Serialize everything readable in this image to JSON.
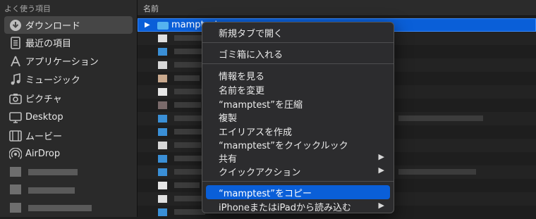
{
  "sidebar": {
    "header": "よく使う項目",
    "items": [
      {
        "label": "ダウンロード",
        "icon": "download-icon",
        "selected": true
      },
      {
        "label": "最近の項目",
        "icon": "recents-icon"
      },
      {
        "label": "アプリケーション",
        "icon": "applications-icon"
      },
      {
        "label": "ミュージック",
        "icon": "music-icon"
      },
      {
        "label": "ピクチャ",
        "icon": "pictures-icon"
      },
      {
        "label": "Desktop",
        "icon": "desktop-icon"
      },
      {
        "label": "ムービー",
        "icon": "movies-icon"
      },
      {
        "label": "AirDrop",
        "icon": "airdrop-icon"
      }
    ]
  },
  "main": {
    "column_name": "名前",
    "selected_file": "mamptest"
  },
  "context_menu": {
    "items": [
      {
        "label": "新規タブで開く"
      },
      {
        "label": "ゴミ箱に入れる"
      },
      {
        "label": "情報を見る"
      },
      {
        "label": "名前を変更"
      },
      {
        "label": "“mamptest”を圧縮"
      },
      {
        "label": "複製"
      },
      {
        "label": "エイリアスを作成"
      },
      {
        "label": "“mamptest”をクイックルック"
      },
      {
        "label": "共有",
        "submenu": true
      },
      {
        "label": "クイックアクション",
        "submenu": true
      },
      {
        "label": "“mamptest”をコピー",
        "highlighted": true
      },
      {
        "label": "iPhoneまたはiPadから読み込む",
        "submenu": true
      }
    ],
    "submenu_glyph": "▶"
  },
  "colors": {
    "accent": "#0a5fd8",
    "folder": "#55b3ef"
  }
}
